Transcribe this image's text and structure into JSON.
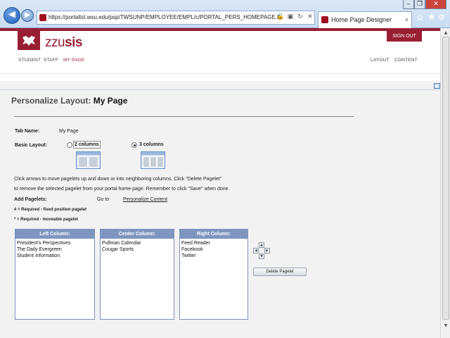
{
  "browser": {
    "url": "https://portaltst.wsu.edu/psp/TWSUNP/EMPLOYEE/EMPL/c/PORTAL_PERS_HOMEPAGE.P",
    "tab_title": "Home Page Designer",
    "tab_close": "×",
    "icons": [
      "back-arrow-icon",
      "forward-arrow-icon",
      "lock-icon",
      "compat-icon",
      "refresh-icon",
      "stop-icon",
      "home-icon",
      "star-icon",
      "gear-icon"
    ]
  },
  "header": {
    "logo_prefix": "zzu",
    "logo_suffix": "sis",
    "sign_out": "SIGN OUT",
    "nav_left": [
      "STUDENT",
      "STAFF",
      "MY PAGE"
    ],
    "nav_right": [
      "LAYOUT",
      "CONTENT"
    ],
    "brand_color": "#981e32"
  },
  "page": {
    "title_prefix": "Personalize Layout:",
    "title_name": "My Page",
    "tab_name_label": "Tab Name:",
    "tab_name_value": "My Page",
    "basic_layout_label": "Basic Layout:",
    "layout_options": [
      {
        "label": "2 columns",
        "selected": false
      },
      {
        "label": "3 columns",
        "selected": true
      }
    ],
    "instructions_line1": "Click arrows to move pagelets up and down or into neighboring columns. Click \"Delete Pagelet\"",
    "instructions_line2": "to remove the selected pagelet from your portal home page. Remember to click \"Save\" when done.",
    "add_pagelets_label": "Add Pagelets:",
    "go_to": "Go to",
    "personalize_content_link": "Personalize Content",
    "legend_fixed": "# = Required - fixed position pagelet",
    "legend_moveable": "* = Required - moveable pagelet"
  },
  "columns": [
    {
      "header": "Left Column:",
      "items": [
        "President's Perspectives",
        "The Daily Evergreen",
        "Student Information"
      ]
    },
    {
      "header": "Center Column:",
      "items": [
        "Pullman Calendar",
        "Cougar Sports"
      ]
    },
    {
      "header": "Right Column:",
      "items": [
        "Feed Reader",
        "Facebook",
        "Twitter"
      ]
    }
  ],
  "arrows": {
    "up": "▲",
    "down": "▼",
    "left": "◀",
    "right": "▶"
  },
  "delete_pagelet": "Delete Pagelet"
}
